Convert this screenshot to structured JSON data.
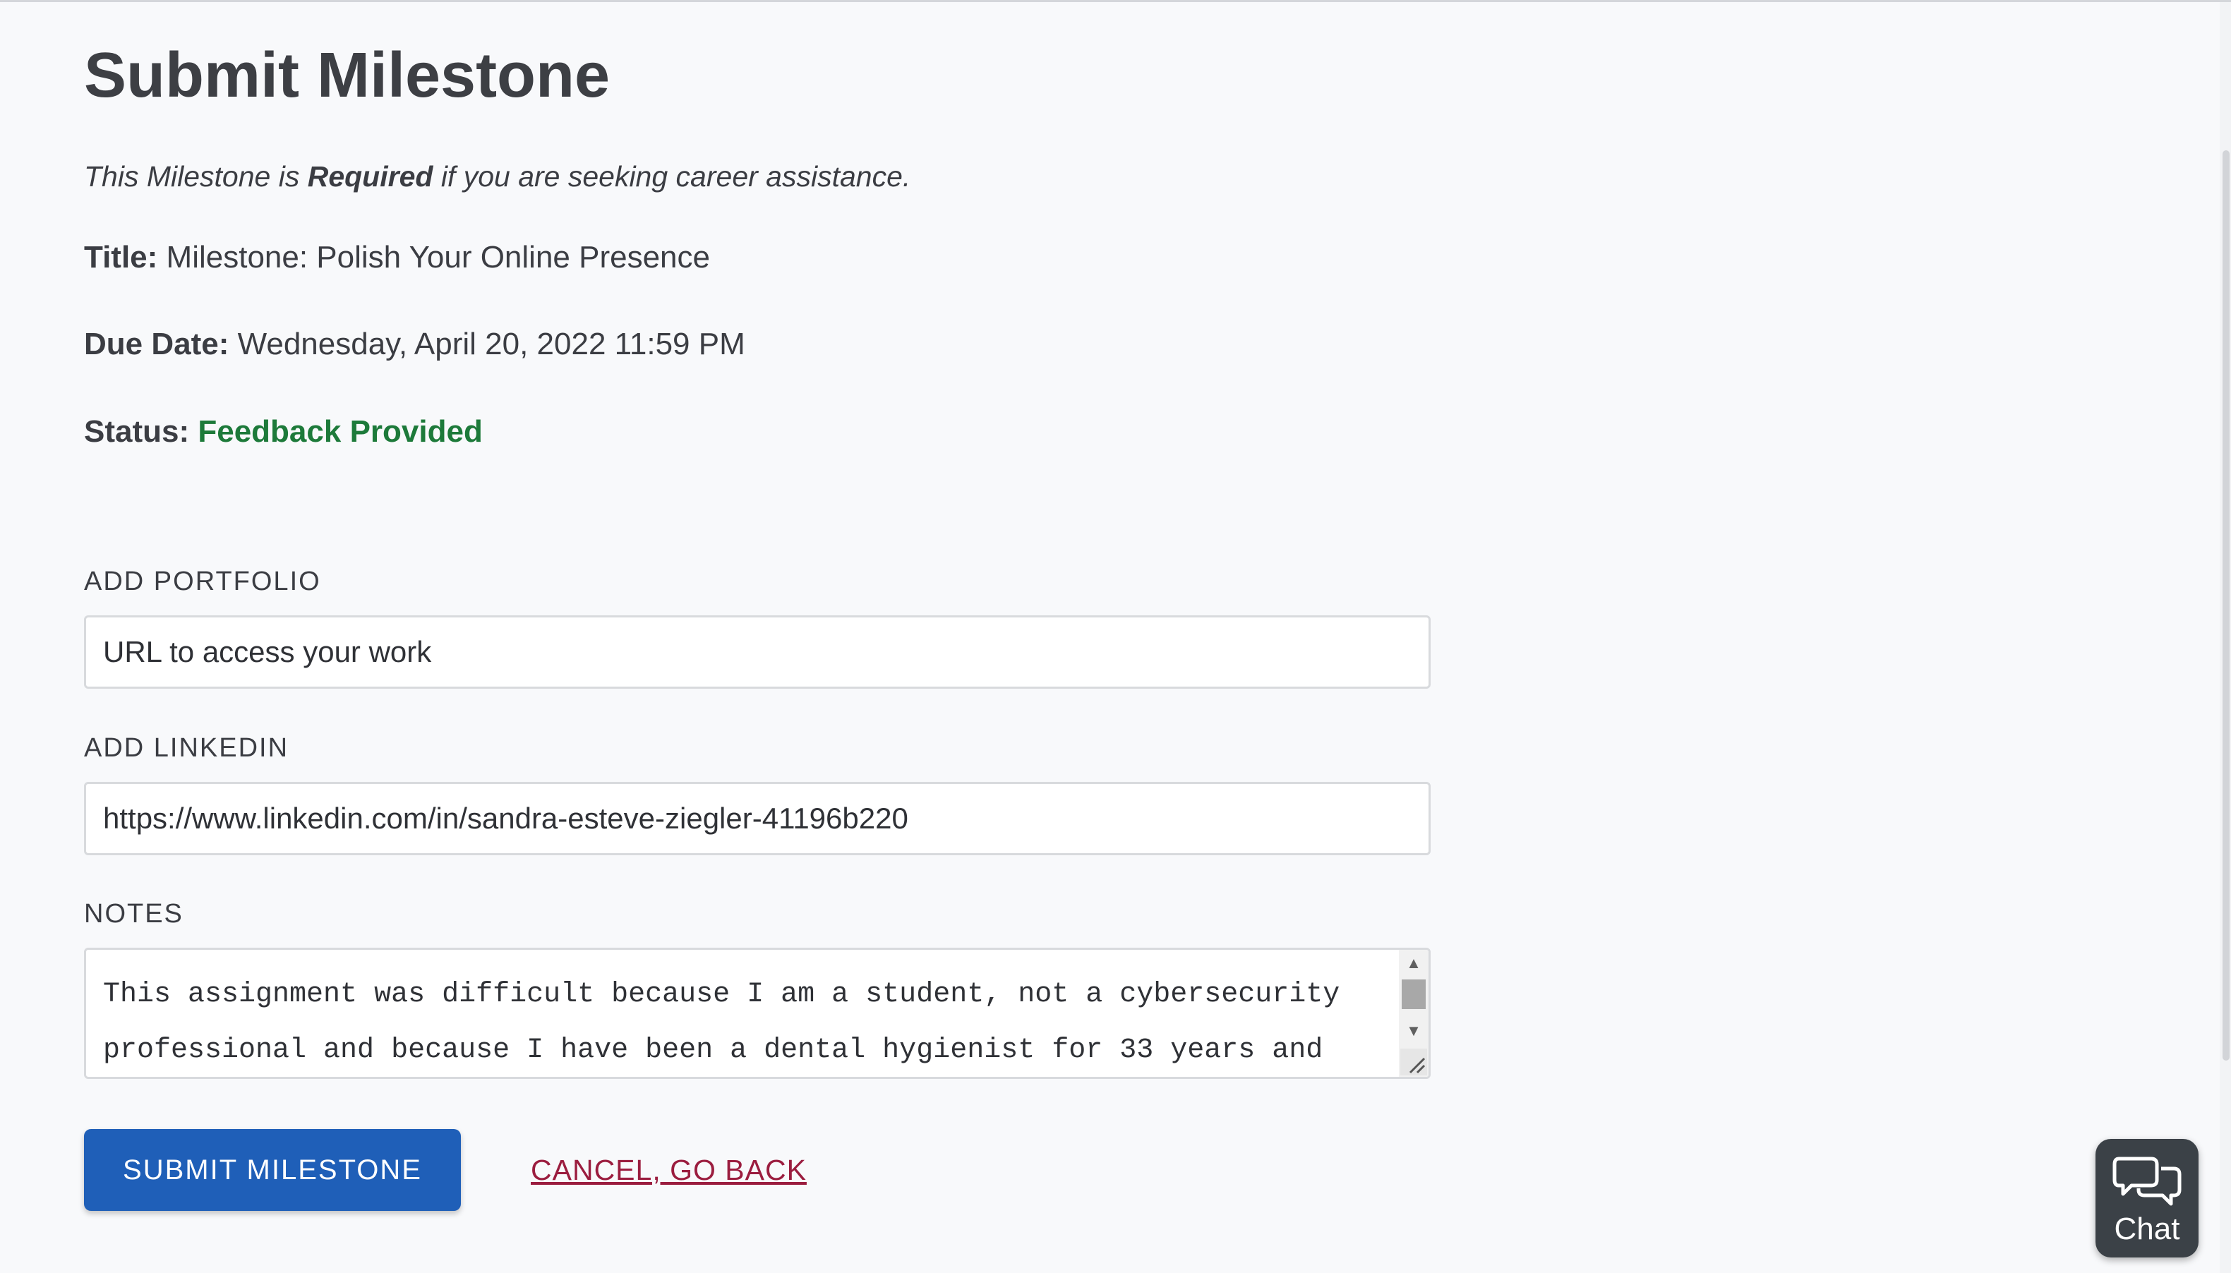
{
  "page": {
    "title": "Submit Milestone",
    "requirement": {
      "prefix": "This Milestone is ",
      "emphasis": "Required",
      "suffix": " if you are seeking career assistance."
    },
    "info": {
      "title_label": "Title:",
      "title_value": "Milestone: Polish Your Online Presence",
      "due_label": "Due Date:",
      "due_value": "Wednesday, April 20, 2022 11:59 PM",
      "status_label": "Status:",
      "status_value": "Feedback Provided",
      "status_color": "#1d7a3a"
    }
  },
  "form": {
    "portfolio": {
      "label": "ADD PORTFOLIO",
      "placeholder": "URL to access your work",
      "value": ""
    },
    "linkedin": {
      "label": "ADD LINKEDIN",
      "placeholder": "",
      "value": "https://www.linkedin.com/in/sandra-esteve-ziegler-41196b220"
    },
    "notes": {
      "label": "NOTES",
      "value": "This assignment was difficult because I am a student, not a cybersecurity professional and because I have been a dental hygienist for 33 years and"
    },
    "submit_label": "SUBMIT MILESTONE",
    "cancel_label": "CANCEL, GO BACK"
  },
  "chat": {
    "label": "Chat",
    "icon": "chat-bubbles-icon"
  },
  "colors": {
    "primary": "#1f5fb8",
    "cancel": "#9b1d3f",
    "status": "#1d7a3a",
    "chat_bg": "#3b4147"
  }
}
